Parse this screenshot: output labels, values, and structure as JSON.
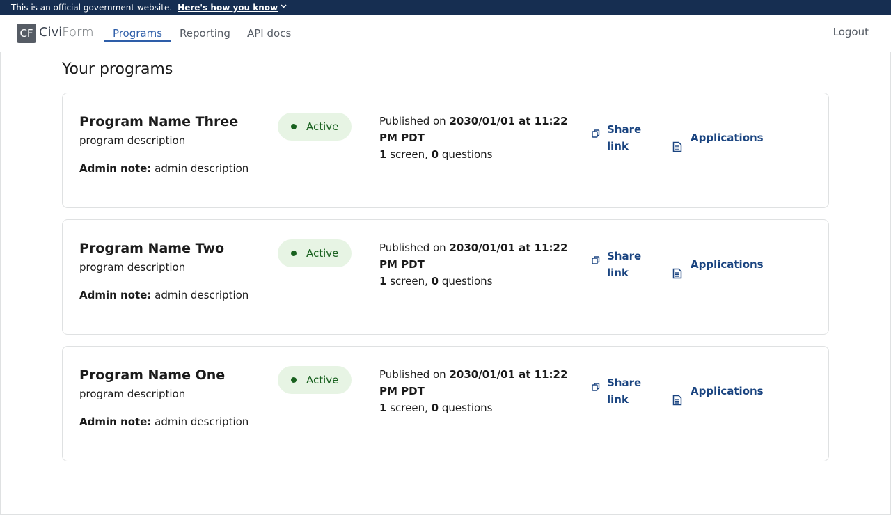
{
  "gov_banner": {
    "text": "This is an official government website.",
    "link": "Here's how you know",
    "chevron": "⌄"
  },
  "header": {
    "logo_mark": "CF",
    "logo_civi": "Civi",
    "logo_form": "Form",
    "nav": [
      "Programs",
      "Reporting",
      "API docs"
    ],
    "logout": "Logout"
  },
  "page": {
    "title": "Your programs"
  },
  "programs": [
    {
      "name": "Program Name Three",
      "description": "program description",
      "admin_note_label": "Admin note:",
      "admin_note": "admin description",
      "status": "Active",
      "published_prefix": "Published on",
      "published_date": "2030/01/01 at 11:22 PM PDT",
      "screens": "1",
      "screens_label": "screen,",
      "questions": "0",
      "questions_label": "questions",
      "share_label": "Share link",
      "applications_label": "Applications"
    },
    {
      "name": "Program Name Two",
      "description": "program description",
      "admin_note_label": "Admin note:",
      "admin_note": "admin description",
      "status": "Active",
      "published_prefix": "Published on",
      "published_date": "2030/01/01 at 11:22 PM PDT",
      "screens": "1",
      "screens_label": "screen,",
      "questions": "0",
      "questions_label": "questions",
      "share_label": "Share link",
      "applications_label": "Applications"
    },
    {
      "name": "Program Name One",
      "description": "program description",
      "admin_note_label": "Admin note:",
      "admin_note": "admin description",
      "status": "Active",
      "published_prefix": "Published on",
      "published_date": "2030/01/01 at 11:22 PM PDT",
      "screens": "1",
      "screens_label": "screen,",
      "questions": "0",
      "questions_label": "questions",
      "share_label": "Share link",
      "applications_label": "Applications"
    }
  ],
  "colors": {
    "banner_bg": "#162e51",
    "link": "#1a4480",
    "nav_active": "#2e5ea9",
    "badge_bg": "#e7f4e4",
    "badge_text": "#19611f"
  },
  "icons": {
    "share": "copy-icon",
    "applications": "document-icon",
    "status": "status-dot-icon"
  }
}
